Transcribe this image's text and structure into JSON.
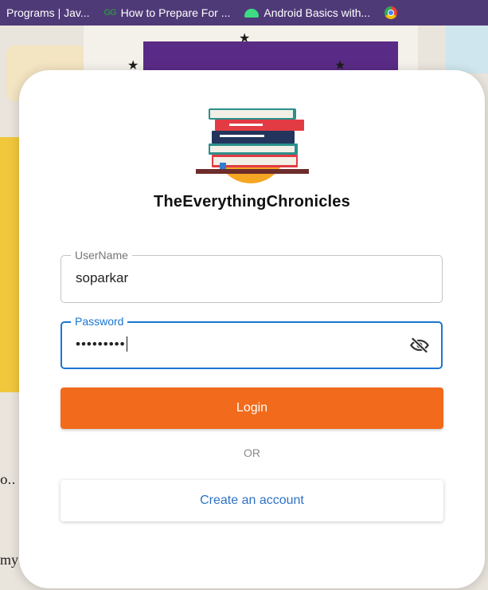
{
  "bookmarks": [
    {
      "label": "Programs | Jav...",
      "icon": "none"
    },
    {
      "label": "How to Prepare For ...",
      "icon": "gfg-icon",
      "icon_text": "GG"
    },
    {
      "label": "Android Basics with...",
      "icon": "android-icon"
    },
    {
      "label": "",
      "icon": "chrome-icon"
    }
  ],
  "background": {
    "left_text": "o..",
    "left_bottom_text": "my"
  },
  "app": {
    "title": "TheEverythingChronicles",
    "logo": "books-stack-logo"
  },
  "form": {
    "username": {
      "label": "UserName",
      "value": "soparkar"
    },
    "password": {
      "label": "Password",
      "value": "•••••••••",
      "toggle_icon": "eye-off-icon"
    },
    "login_label": "Login",
    "or_label": "OR",
    "create_label": "Create an account"
  },
  "colors": {
    "accent_orange": "#f26a1b",
    "focus_blue": "#1976d2",
    "link_blue": "#2e72c6",
    "bookmark_bar": "#4f3a78"
  }
}
